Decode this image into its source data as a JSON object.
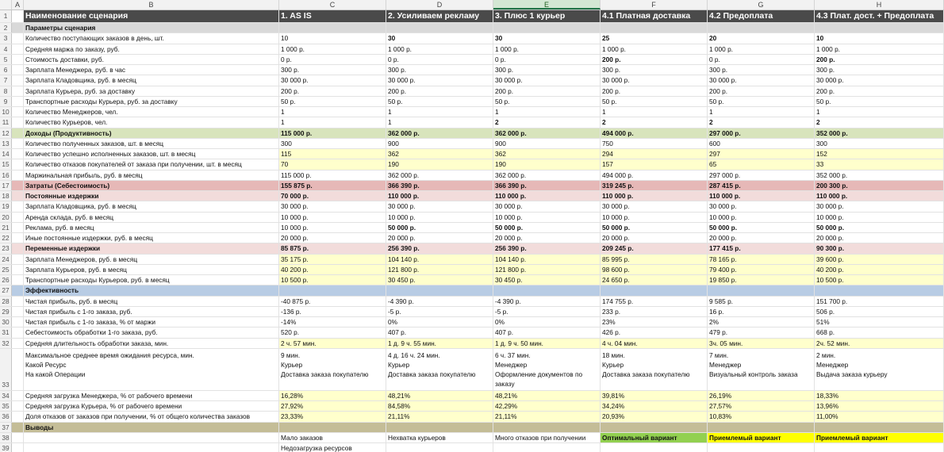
{
  "columns": [
    "A",
    "B",
    "C",
    "D",
    "E",
    "F",
    "G",
    "H"
  ],
  "header_row": {
    "name": "Наименование сценария",
    "c": "1. AS IS",
    "d": "2. Усиливаем рекламу",
    "e": "3. Плюс 1 курьер",
    "f": "4.1 Платная доставка",
    "g": "4.2 Предоплата",
    "h": "4.3 Плат. дост. + Предоплата"
  },
  "sections": {
    "params": "Параметры сценария",
    "effect": "Эффективность",
    "outputs": "Выводы"
  },
  "rows": {
    "r3": {
      "label": "Количество поступающих заказов в день, шт.",
      "c": "10",
      "d": "30",
      "e": "30",
      "f": "25",
      "g": "20",
      "h": "10"
    },
    "r4": {
      "label": "Средняя маржа по заказу, руб.",
      "c": "1 000 р.",
      "d": "1 000 р.",
      "e": "1 000 р.",
      "f": "1 000 р.",
      "g": "1 000 р.",
      "h": "1 000 р."
    },
    "r5": {
      "label": "Стоимость доставки, руб.",
      "c": "0 р.",
      "d": "0 р.",
      "e": "0 р.",
      "f": "200 р.",
      "g": "0 р.",
      "h": "200 р."
    },
    "r6": {
      "label": "Зарплата Менеджера, руб. в час",
      "c": "300 р.",
      "d": "300 р.",
      "e": "300 р.",
      "f": "300 р.",
      "g": "300 р.",
      "h": "300 р."
    },
    "r7": {
      "label": "Зарплата Кладовщика, руб. в месяц",
      "c": "30 000 р.",
      "d": "30 000 р.",
      "e": "30 000 р.",
      "f": "30 000 р.",
      "g": "30 000 р.",
      "h": "30 000 р."
    },
    "r8": {
      "label": "Зарплата Курьера, руб. за доставку",
      "c": "200 р.",
      "d": "200 р.",
      "e": "200 р.",
      "f": "200 р.",
      "g": "200 р.",
      "h": "200 р."
    },
    "r9": {
      "label": "Транспортные расходы Курьера, руб. за доставку",
      "c": "50 р.",
      "d": "50 р.",
      "e": "50 р.",
      "f": "50 р.",
      "g": "50 р.",
      "h": "50 р."
    },
    "r10": {
      "label": "Количество Менеджеров, чел.",
      "c": "1",
      "d": "1",
      "e": "1",
      "f": "1",
      "g": "1",
      "h": "1"
    },
    "r11": {
      "label": "Количество Курьеров, чел.",
      "c": "1",
      "d": "1",
      "e": "2",
      "f": "2",
      "g": "2",
      "h": "2"
    },
    "r12": {
      "label": "Доходы (Продуктивность)",
      "c": "115 000 р.",
      "d": "362 000 р.",
      "e": "362 000 р.",
      "f": "494 000 р.",
      "g": "297 000 р.",
      "h": "352 000 р."
    },
    "r13": {
      "label": "Количество полученных заказов, шт. в месяц",
      "c": "300",
      "d": "900",
      "e": "900",
      "f": "750",
      "g": "600",
      "h": "300"
    },
    "r14": {
      "label": "Количество успешно исполненных заказов, шт. в месяц",
      "c": "115",
      "d": "362",
      "e": "362",
      "f": "294",
      "g": "297",
      "h": "152"
    },
    "r15": {
      "label": "Количество отказов покупателей от заказа при получении, шт. в месяц",
      "c": "70",
      "d": "190",
      "e": "190",
      "f": "157",
      "g": "65",
      "h": "33"
    },
    "r16": {
      "label": "Маржинальная прибыль, руб. в месяц",
      "c": "115 000 р.",
      "d": "362 000 р.",
      "e": "362 000 р.",
      "f": "494 000 р.",
      "g": "297 000 р.",
      "h": "352 000 р."
    },
    "r17": {
      "label": "Затраты (Себестоимость)",
      "c": "155 875 р.",
      "d": "366 390 р.",
      "e": "366 390 р.",
      "f": "319 245 р.",
      "g": "287 415 р.",
      "h": "200 300 р."
    },
    "r18": {
      "label": "Постоянные издержки",
      "c": "70 000 р.",
      "d": "110 000 р.",
      "e": "110 000 р.",
      "f": "110 000 р.",
      "g": "110 000 р.",
      "h": "110 000 р."
    },
    "r19": {
      "label": "Зарплата Кладовщика, руб. в месяц",
      "c": "30 000 р.",
      "d": "30 000 р.",
      "e": "30 000 р.",
      "f": "30 000 р.",
      "g": "30 000 р.",
      "h": "30 000 р."
    },
    "r20": {
      "label": "Аренда склада, руб. в месяц",
      "c": "10 000 р.",
      "d": "10 000 р.",
      "e": "10 000 р.",
      "f": "10 000 р.",
      "g": "10 000 р.",
      "h": "10 000 р."
    },
    "r21": {
      "label": "Реклама, руб. в месяц",
      "c": "10 000 р.",
      "d": "50 000 р.",
      "e": "50 000 р.",
      "f": "50 000 р.",
      "g": "50 000 р.",
      "h": "50 000 р."
    },
    "r22": {
      "label": "Иные постоянные издержки, руб. в месяц",
      "c": "20 000 р.",
      "d": "20 000 р.",
      "e": "20 000 р.",
      "f": "20 000 р.",
      "g": "20 000 р.",
      "h": "20 000 р."
    },
    "r23": {
      "label": "Переменные издержки",
      "c": "85 875 р.",
      "d": "256 390 р.",
      "e": "256 390 р.",
      "f": "209 245 р.",
      "g": "177 415 р.",
      "h": "90 300 р."
    },
    "r24": {
      "label": "Зарплата Менеджеров, руб. в месяц",
      "c": "35 175 р.",
      "d": "104 140 р.",
      "e": "104 140 р.",
      "f": "85 995 р.",
      "g": "78 165 р.",
      "h": "39 600 р."
    },
    "r25": {
      "label": "Зарплата Курьеров, руб. в месяц",
      "c": "40 200 р.",
      "d": "121 800 р.",
      "e": "121 800 р.",
      "f": "98 600 р.",
      "g": "79 400 р.",
      "h": "40 200 р."
    },
    "r26": {
      "label": "Транспортные расходы Курьеров, руб. в месяц",
      "c": "10 500 р.",
      "d": "30 450 р.",
      "e": "30 450 р.",
      "f": "24 650 р.",
      "g": "19 850 р.",
      "h": "10 500 р."
    },
    "r28": {
      "label": "Чистая прибыль, руб. в месяц",
      "c": "-40 875 р.",
      "d": "-4 390 р.",
      "e": "-4 390 р.",
      "f": "174 755 р.",
      "g": "9 585 р.",
      "h": "151 700 р."
    },
    "r29": {
      "label": "Чистая прибыль с 1-го заказа, руб.",
      "c": "-136 р.",
      "d": "-5 р.",
      "e": "-5 р.",
      "f": "233 р.",
      "g": "16 р.",
      "h": "506 р."
    },
    "r30": {
      "label": "Чистая прибыль с 1-го заказа, % от маржи",
      "c": "-14%",
      "d": "0%",
      "e": "0%",
      "f": "23%",
      "g": "2%",
      "h": "51%"
    },
    "r31": {
      "label": "Себестоимость обработки 1-го заказа, руб.",
      "c": "520 р.",
      "d": "407 р.",
      "e": "407 р.",
      "f": "426 р.",
      "g": "479 р.",
      "h": "668 р."
    },
    "r32": {
      "label": "Средняя длительность обработки заказа, мин.",
      "c": "2 ч. 57 мин.",
      "d": "1 д. 9 ч. 55 мин.",
      "e": "1 д. 9 ч. 50 мин.",
      "f": "4 ч. 04 мин.",
      "g": "3ч. 05 мин.",
      "h": "2ч. 52 мин."
    },
    "r33": {
      "label1": "Максимальное среднее время ожидания ресурса, мин.",
      "label2": "Какой Ресурс",
      "label3": "На какой Операции",
      "c": [
        "9 мин.",
        "Курьер",
        "Доставка заказа покупателю"
      ],
      "d": [
        "4 д. 16 ч. 24 мин.",
        "Курьер",
        "Доставка заказа покупателю"
      ],
      "e": [
        "6 ч. 37 мин.",
        "Менеджер",
        "Оформление документов по заказу"
      ],
      "f": [
        "18 мин.",
        "Курьер",
        "Доставка заказа покупателю"
      ],
      "g": [
        "7 мин.",
        "Менеджер",
        "Визуальный контроль заказа"
      ],
      "h": [
        "2 мин.",
        "Менеджер",
        "Выдача заказа курьеру"
      ]
    },
    "r34": {
      "label": "Средняя загрузка Менеджера, % от рабочего времени",
      "c": "16,28%",
      "d": "48,21%",
      "e": "48,21%",
      "f": "39,81%",
      "g": "26,19%",
      "h": "18,33%"
    },
    "r35": {
      "label": "Средняя загрузка Курьера, % от рабочего времени",
      "c": "27,92%",
      "d": "84,58%",
      "e": "42,29%",
      "f": "34,24%",
      "g": "27,57%",
      "h": "13,96%"
    },
    "r36": {
      "label": "Доля отказов от заказов при получении, % от общего количества заказов",
      "c": "23,33%",
      "d": "21,11%",
      "e": "21,11%",
      "f": "20,93%",
      "g": "10,83%",
      "h": "11,00%"
    },
    "r38": {
      "c": "Мало заказов",
      "d": "Нехватка курьеров",
      "e": "Много отказов при получении",
      "f": "Оптимальный вариант",
      "g": "Приемлемый вариант",
      "h": "Приемлемый вариант"
    },
    "r39": {
      "c": "Недозагрузка ресурсов"
    }
  }
}
